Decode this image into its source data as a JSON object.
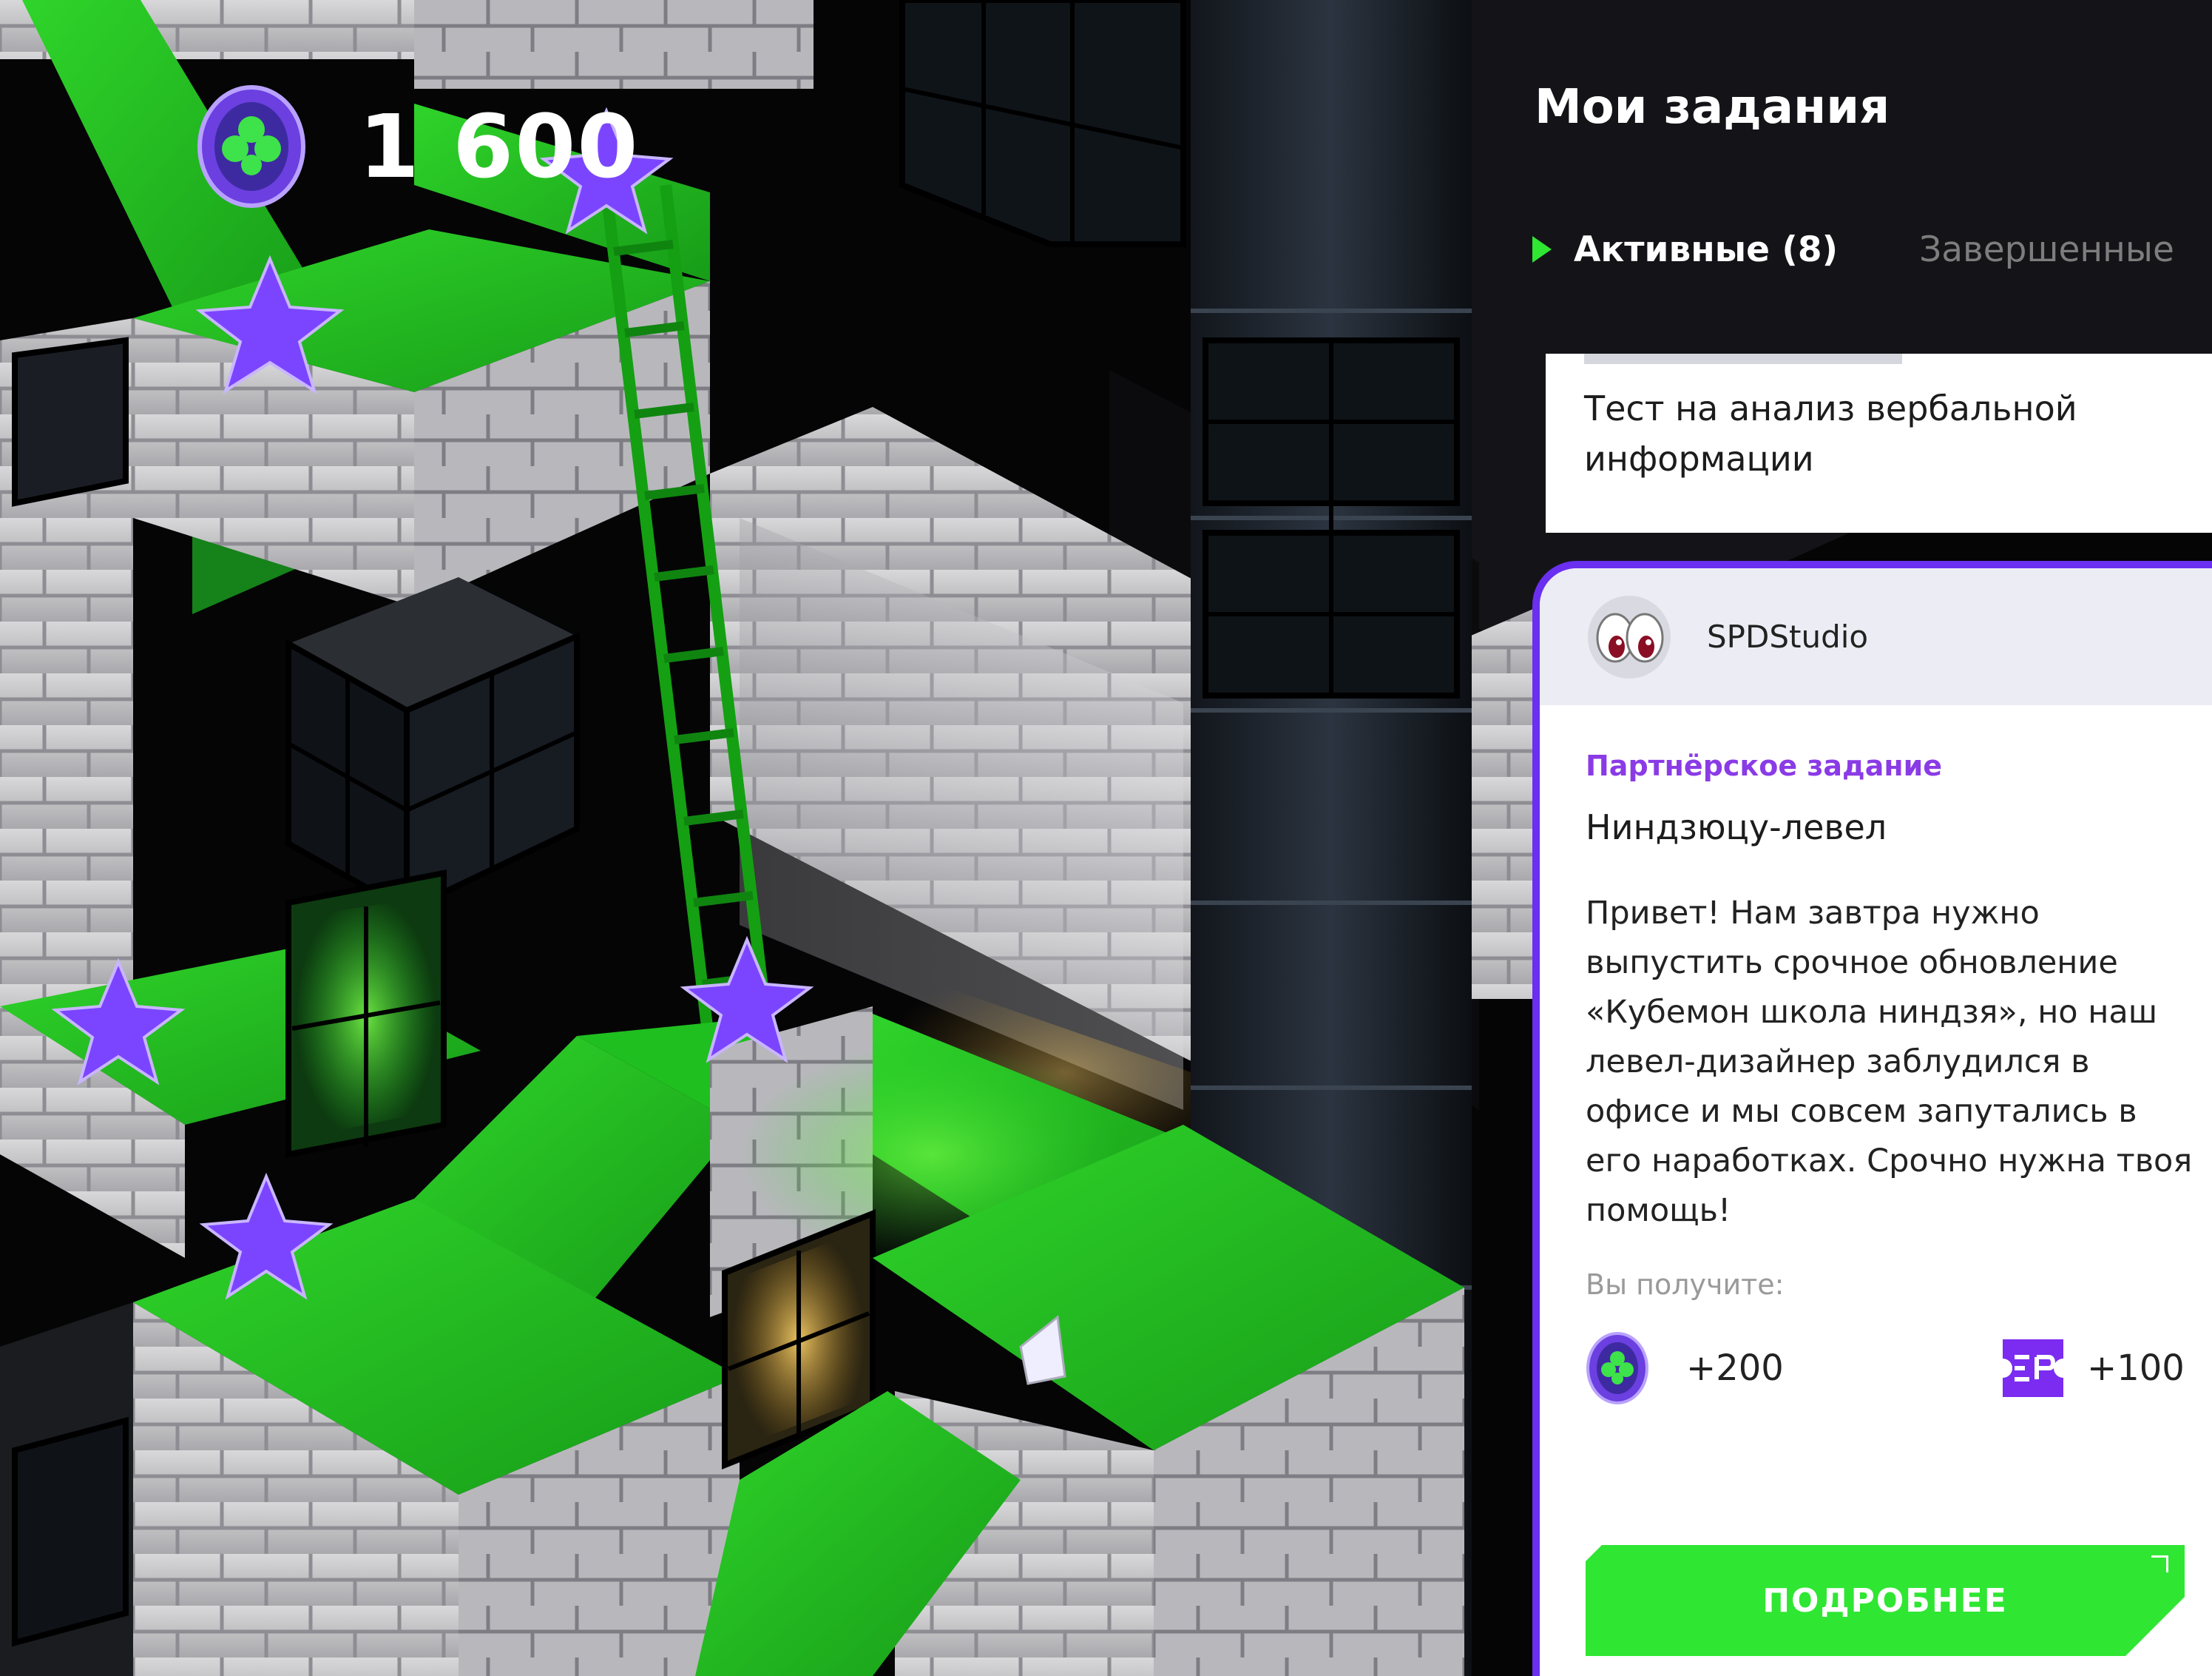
{
  "hud": {
    "coin_balance": "1 600",
    "coin_icon": "clover-coin-icon"
  },
  "panel": {
    "title": "Мои задания",
    "tabs": [
      {
        "label": "Активные (8)",
        "active": true
      },
      {
        "label": "Завершенные",
        "active": false
      }
    ]
  },
  "tasks": {
    "top_card": {
      "title_line1": "Тест на анализ вербальной",
      "title_line2": "информации"
    },
    "partner_card": {
      "partner_name": "SPDStudio",
      "label": "Партнёрское задание",
      "title": "Ниндзюцу-левел",
      "description": "Привет! Нам завтра нужно выпустить срочное обновление «Кубемон школа ниндзя», но наш левел-дизайнер заблудился в офисе и мы совсем запутались в его наработках. Срочно нужна твоя помощь!",
      "reward_label": "Вы получите:",
      "rewards": [
        {
          "icon": "clover-coin-icon",
          "value": "+200"
        },
        {
          "icon": "ticket-icon",
          "value": "+100"
        }
      ],
      "button_label": "ПОДРОБНЕЕ"
    }
  },
  "colors": {
    "accent_green": "#2fe633",
    "accent_purple": "#6a2ff0",
    "partner_label": "#8a3be6"
  }
}
